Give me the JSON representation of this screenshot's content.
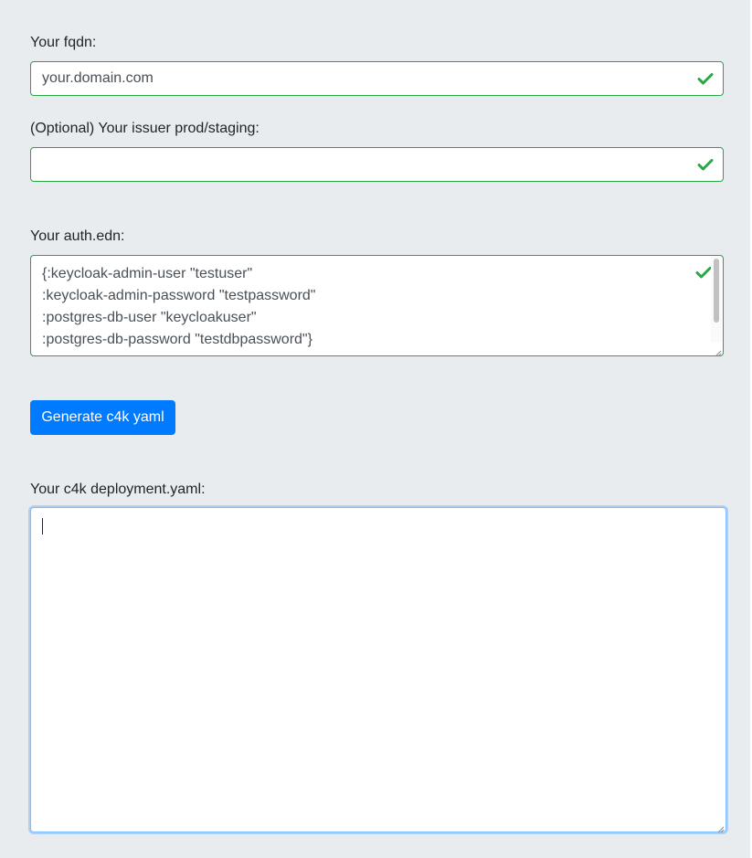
{
  "form": {
    "fqdn": {
      "label": "Your fqdn:",
      "value": "your.domain.com",
      "valid": true
    },
    "issuer": {
      "label": "(Optional) Your issuer prod/staging:",
      "value": "",
      "valid": true
    },
    "auth": {
      "label": "Your auth.edn:",
      "lines": [
        "{:keycloak-admin-user \"testuser\"",
        ":keycloak-admin-password \"testpassword\"",
        ":postgres-db-user \"keycloakuser\"",
        ":postgres-db-password \"testdbpassword\"}"
      ],
      "valid": true
    },
    "generate_button_label": "Generate c4k yaml",
    "output": {
      "label": "Your c4k deployment.yaml:",
      "value": ""
    }
  },
  "colors": {
    "valid": "#28a745",
    "primary": "#007bff",
    "panel_background": "#e9ecef"
  },
  "icons": {
    "valid_indicator": "check-icon"
  }
}
